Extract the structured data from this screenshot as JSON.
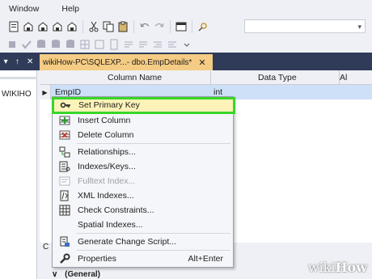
{
  "menubar": {
    "items": [
      "Window",
      "Help"
    ]
  },
  "left_panel": {
    "header_glyphs": [
      "▾",
      "↑",
      "✕"
    ],
    "text": "WIKIHO"
  },
  "document_tab": {
    "title": "wikiHow-PC\\SQLEXP...- dbo.EmpDetails*",
    "close": "✕"
  },
  "grid": {
    "headers": [
      "Column Name",
      "Data Type",
      "Al"
    ],
    "selected_row": {
      "column_name": "EmpID",
      "data_type": "int"
    }
  },
  "context_menu": {
    "items": [
      {
        "label": "Set Primary Key",
        "icon": "key-icon",
        "shortcut": "",
        "disabled": false,
        "highlighted": true
      },
      {
        "label": "Insert Column",
        "icon": "insert-column-icon",
        "shortcut": "",
        "disabled": false
      },
      {
        "label": "Delete Column",
        "icon": "delete-column-icon",
        "shortcut": "",
        "disabled": false
      },
      {
        "label": "Relationships...",
        "icon": "relationships-icon",
        "shortcut": "",
        "disabled": false
      },
      {
        "label": "Indexes/Keys...",
        "icon": "indexes-icon",
        "shortcut": "",
        "disabled": false
      },
      {
        "label": "Fulltext Index...",
        "icon": "fulltext-icon",
        "shortcut": "",
        "disabled": true
      },
      {
        "label": "XML Indexes...",
        "icon": "xml-icon",
        "shortcut": "",
        "disabled": false
      },
      {
        "label": "Check Constraints...",
        "icon": "check-icon",
        "shortcut": "",
        "disabled": false
      },
      {
        "label": "Spatial Indexes...",
        "icon": "",
        "shortcut": "",
        "disabled": false
      },
      {
        "label": "Generate Change Script...",
        "icon": "script-icon",
        "shortcut": "",
        "disabled": false
      },
      {
        "label": "Properties",
        "icon": "wrench-icon",
        "shortcut": "Alt+Enter",
        "disabled": false
      }
    ]
  },
  "bottom": {
    "section": "(General)",
    "section_toggle": "∨",
    "tab_fragment": "C"
  },
  "watermark": {
    "wiki": "wiki",
    "how": "How"
  },
  "colors": {
    "accent_tab": "#f5cc84",
    "highlight": "#39d62a",
    "selection": "#cde0f7",
    "dark_bar": "#2f3b58"
  }
}
